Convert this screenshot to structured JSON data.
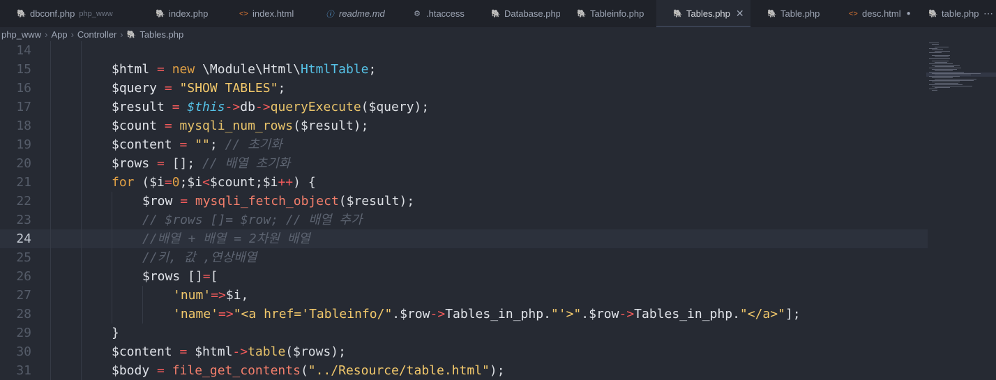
{
  "tabs": [
    {
      "icon": "php-elephant-icon",
      "glyph": "🐘",
      "label": "dbconf.php",
      "sub": "php_www",
      "active": false,
      "italic": false
    },
    {
      "icon": "php-elephant-icon",
      "glyph": "🐘",
      "label": "index.php",
      "active": false,
      "italic": false
    },
    {
      "icon": "html-brackets-icon",
      "glyph": "<>",
      "label": "index.html",
      "active": false,
      "italic": false
    },
    {
      "icon": "info-icon",
      "glyph": "ⓘ",
      "label": "readme.md",
      "active": false,
      "italic": true
    },
    {
      "icon": "gear-icon",
      "glyph": "⚙",
      "label": ".htaccess",
      "active": false,
      "italic": false
    },
    {
      "icon": "php-elephant-icon",
      "glyph": "🐘",
      "label": "Database.php",
      "active": false,
      "italic": false
    },
    {
      "icon": "php-elephant-icon",
      "glyph": "🐘",
      "label": "Tableinfo.php",
      "active": false,
      "italic": false
    },
    {
      "icon": "php-elephant-icon",
      "glyph": "🐘",
      "label": "Tables.php",
      "active": true,
      "italic": false,
      "close": "✕"
    },
    {
      "icon": "php-elephant-icon",
      "glyph": "🐘",
      "label": "Table.php",
      "active": false,
      "italic": false
    },
    {
      "icon": "html-brackets-icon",
      "glyph": "<>",
      "label": "desc.html",
      "active": false,
      "italic": false,
      "dirty": "●"
    },
    {
      "icon": "php-elephant-icon",
      "glyph": "🐘",
      "label": "table.php",
      "active": false,
      "italic": false
    }
  ],
  "breadcrumb": [
    "php_www",
    "App",
    "Controller",
    "Tables.php"
  ],
  "breadcrumb_sep": "›",
  "current_line": 24,
  "lines": [
    {
      "n": "14",
      "tokens": []
    },
    {
      "n": "15",
      "tokens": [
        [
          "var",
          "$html"
        ],
        [
          "op",
          " = "
        ],
        [
          "kw",
          "new"
        ],
        [
          "ns",
          " \\Module\\Html\\"
        ],
        [
          "cls",
          "HtmlTable"
        ],
        [
          "pun",
          ";"
        ]
      ]
    },
    {
      "n": "16",
      "tokens": [
        [
          "var",
          "$query"
        ],
        [
          "op",
          " = "
        ],
        [
          "str",
          "\"SHOW TABLES\""
        ],
        [
          "pun",
          ";"
        ]
      ]
    },
    {
      "n": "17",
      "tokens": [
        [
          "var",
          "$result"
        ],
        [
          "op",
          " = "
        ],
        [
          "this",
          "$this"
        ],
        [
          "arrow",
          "->"
        ],
        [
          "var",
          "db"
        ],
        [
          "arrow",
          "->"
        ],
        [
          "fn",
          "queryExecute"
        ],
        [
          "pun",
          "($query);"
        ]
      ]
    },
    {
      "n": "18",
      "tokens": [
        [
          "var",
          "$count"
        ],
        [
          "op",
          " = "
        ],
        [
          "fn",
          "mysqli_num_rows"
        ],
        [
          "pun",
          "($result);"
        ]
      ]
    },
    {
      "n": "19",
      "tokens": [
        [
          "var",
          "$content"
        ],
        [
          "op",
          " = "
        ],
        [
          "str",
          "\"\""
        ],
        [
          "pun",
          "; "
        ],
        [
          "cmt",
          "// 초기화"
        ]
      ]
    },
    {
      "n": "20",
      "tokens": [
        [
          "var",
          "$rows"
        ],
        [
          "op",
          " = "
        ],
        [
          "pun",
          "[]; "
        ],
        [
          "cmt",
          "// 배열 초기화"
        ]
      ]
    },
    {
      "n": "21",
      "tokens": [
        [
          "kw",
          "for"
        ],
        [
          "pun",
          " ($i"
        ],
        [
          "op",
          "="
        ],
        [
          "num",
          "0"
        ],
        [
          "pun",
          ";$i"
        ],
        [
          "op",
          "<"
        ],
        [
          "pun",
          "$count;$i"
        ],
        [
          "op",
          "++"
        ],
        [
          "pun",
          ") {"
        ]
      ]
    },
    {
      "n": "22",
      "tokens": [
        [
          "var",
          "    $row"
        ],
        [
          "op",
          " = "
        ],
        [
          "fnr",
          "mysqli_fetch_object"
        ],
        [
          "pun",
          "($result);"
        ]
      ]
    },
    {
      "n": "23",
      "tokens": [
        [
          "cmt",
          "    // $rows []= $row; // 배열 추가"
        ]
      ]
    },
    {
      "n": "24",
      "tokens": [
        [
          "cmt",
          "    //배열 + 배열 = 2차원 배열"
        ]
      ]
    },
    {
      "n": "25",
      "tokens": [
        [
          "cmt",
          "    //키, 값 ,연상배열"
        ]
      ]
    },
    {
      "n": "26",
      "tokens": [
        [
          "var",
          "    $rows "
        ],
        [
          "pun",
          "[]"
        ],
        [
          "op",
          "="
        ],
        [
          "pun",
          "["
        ]
      ]
    },
    {
      "n": "27",
      "tokens": [
        [
          "str",
          "        'num'"
        ],
        [
          "op",
          "=>"
        ],
        [
          "pun",
          "$i,"
        ]
      ]
    },
    {
      "n": "28",
      "tokens": [
        [
          "str",
          "        'name'"
        ],
        [
          "op",
          "=>"
        ],
        [
          "str",
          "\"<a href='Tableinfo/\""
        ],
        [
          "pun",
          "."
        ],
        [
          "var",
          "$row"
        ],
        [
          "arrow",
          "->"
        ],
        [
          "var",
          "Tables_in_php"
        ],
        [
          "pun",
          "."
        ],
        [
          "str",
          "\"'>\""
        ],
        [
          "pun",
          "."
        ],
        [
          "var",
          "$row"
        ],
        [
          "arrow",
          "->"
        ],
        [
          "var",
          "Tables_in_php"
        ],
        [
          "pun",
          "."
        ],
        [
          "str",
          "\"</a>\""
        ],
        [
          "pun",
          "];"
        ]
      ]
    },
    {
      "n": "29",
      "tokens": [
        [
          "pun",
          "}"
        ]
      ]
    },
    {
      "n": "30",
      "tokens": [
        [
          "var",
          "$content"
        ],
        [
          "op",
          " = "
        ],
        [
          "var",
          "$html"
        ],
        [
          "arrow",
          "->"
        ],
        [
          "fn",
          "table"
        ],
        [
          "pun",
          "($rows);"
        ]
      ]
    },
    {
      "n": "31",
      "tokens": [
        [
          "var",
          "$body"
        ],
        [
          "op",
          " = "
        ],
        [
          "fnr",
          "file_get_contents"
        ],
        [
          "pun",
          "("
        ],
        [
          "str",
          "\"../Resource/table.html\""
        ],
        [
          "pun",
          ");"
        ]
      ]
    }
  ]
}
